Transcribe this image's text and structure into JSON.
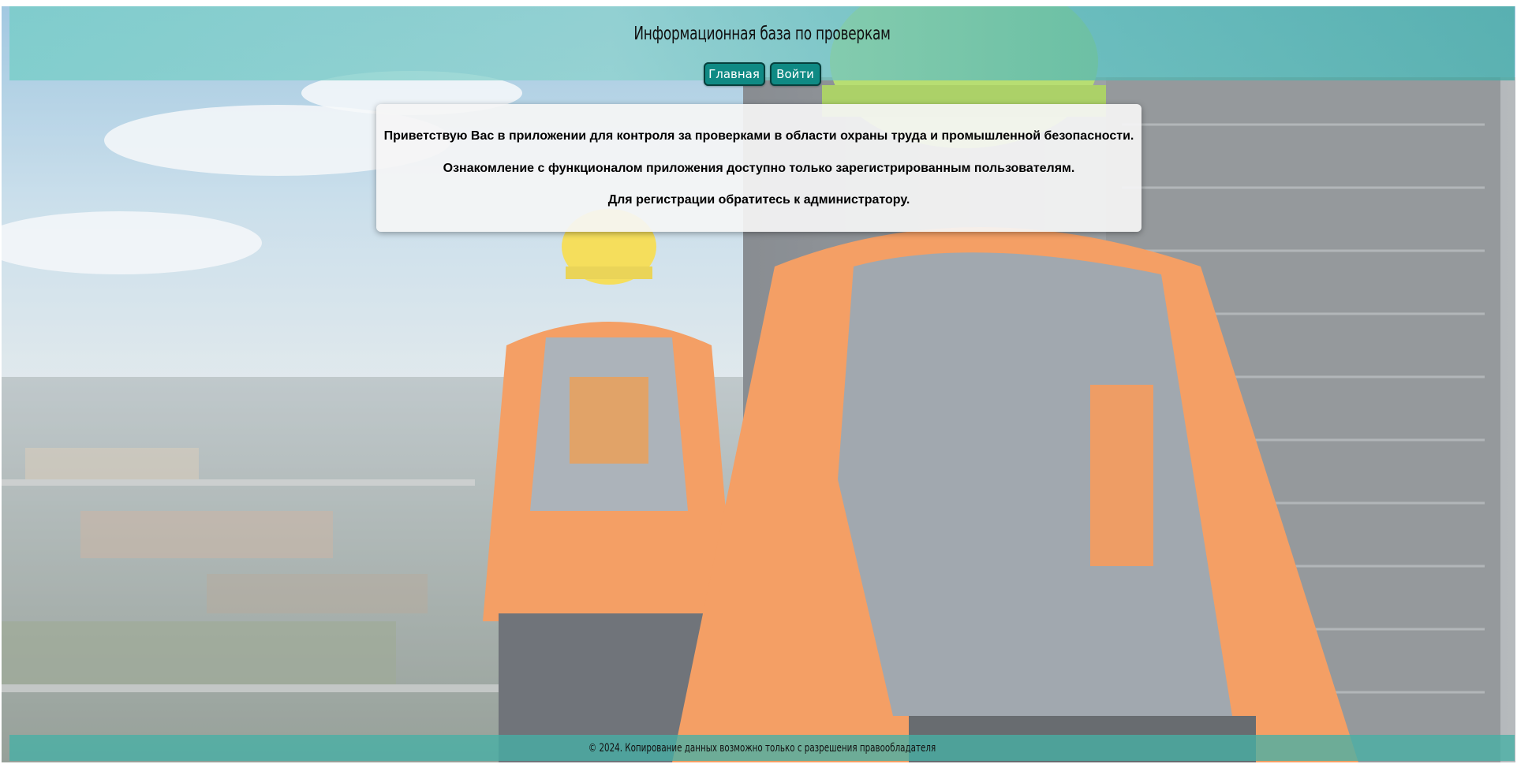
{
  "header": {
    "title": "Информационная база по проверкам",
    "nav": [
      {
        "label": "Главная"
      },
      {
        "label": "Войти"
      }
    ]
  },
  "welcome": {
    "lines": [
      "Приветствую Вас в приложении для контроля за проверками в области охраны труда и промышленной безопасности.",
      "Ознакомление с функционалом приложения доступно только зарегистрированным пользователям.",
      "Для регистрации обратитесь к администратору."
    ]
  },
  "footer": {
    "copyright": "© 2024. Копирование данных возможно только с разрешения правообладателя"
  },
  "colors": {
    "header_bg": "#8fd3cf",
    "nav_button_bg": "#0f8a84",
    "footer_bg": "#46afa5",
    "vest_orange": "#f07a2a",
    "helmet_yellow": "#f2d21e",
    "helmet_green": "#9bd23c"
  },
  "background": {
    "icon": "construction-workers-scene"
  }
}
